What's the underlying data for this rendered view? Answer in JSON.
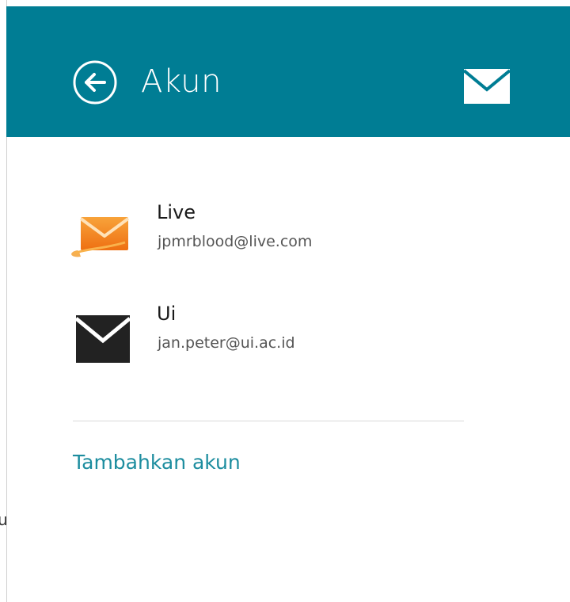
{
  "header": {
    "title": "Akun",
    "back_icon": "circle-arrow-left-icon",
    "mail_icon": "mail-envelope-icon",
    "background": "#007d94"
  },
  "accounts": [
    {
      "name": "Live",
      "email": "jpmrblood@live.com",
      "icon": "outlook-live-mail-icon",
      "icon_color": "#f28a1a"
    },
    {
      "name": "Ui",
      "email": "jan.peter@ui.ac.id",
      "icon": "generic-mail-envelope-icon",
      "icon_color": "#222222"
    }
  ],
  "add_account_label": "Tambahkan akun",
  "link_color": "#1d8d9f",
  "clipped_left_text": "u"
}
